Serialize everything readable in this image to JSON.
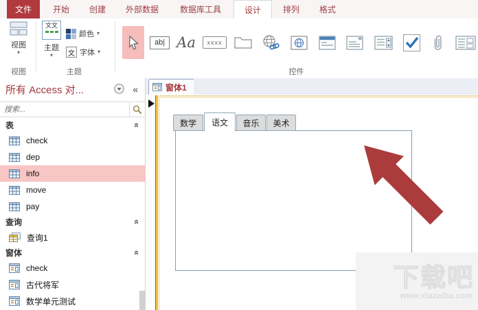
{
  "ribbon": {
    "tabs": [
      {
        "label": "文件",
        "style": "file"
      },
      {
        "label": "开始"
      },
      {
        "label": "创建"
      },
      {
        "label": "外部数据"
      },
      {
        "label": "数据库工具"
      },
      {
        "label": "设计",
        "style": "active"
      },
      {
        "label": "排列"
      },
      {
        "label": "格式"
      }
    ],
    "groups": {
      "views": {
        "label": "视图",
        "button": "视图"
      },
      "themes": {
        "label": "主题",
        "theme_button": "主题",
        "theme_icon_glyph": "文文",
        "colors_button": "颜色",
        "fonts_button": "字体",
        "fonts_icon_glyph": "文"
      },
      "controls": {
        "label": "控件",
        "textbox_glyph": "ab|",
        "label_glyph": "Aa",
        "button_glyph": "xxxx"
      }
    }
  },
  "sidebar": {
    "title": "所有 Access 对...",
    "search_placeholder": "搜索...",
    "groups": [
      {
        "label": "表",
        "items": [
          {
            "label": "check"
          },
          {
            "label": "dep"
          },
          {
            "label": "info",
            "selected": true
          },
          {
            "label": "move"
          },
          {
            "label": "pay"
          }
        ]
      },
      {
        "label": "查询",
        "items": [
          {
            "label": "查询1"
          }
        ]
      },
      {
        "label": "窗体",
        "items": [
          {
            "label": "check"
          },
          {
            "label": "古代将军"
          },
          {
            "label": "数学单元测试"
          }
        ]
      }
    ]
  },
  "document": {
    "tab_label": "窗体1"
  },
  "form": {
    "tabs": [
      {
        "label": "数学"
      },
      {
        "label": "语文",
        "selected": true
      },
      {
        "label": "音乐"
      },
      {
        "label": "美术"
      }
    ]
  },
  "watermark": {
    "title": "下载吧",
    "url": "www.xiazaiba.com"
  },
  "icons": {
    "dropdown_arrow": "▾",
    "collapse": "«",
    "chevron": "«",
    "check": "✓"
  },
  "colors": {
    "accent": "#a4373a",
    "file_tab_bg": "#b13a3e",
    "selection_pink": "#f8c6c4",
    "control_highlight": "#f7bcbc",
    "arrow_red": "#ac3c3c",
    "form_edge_gold": "#f0c04a",
    "tab_gray": "#dcdcdc",
    "tab_border": "#8fa6b4"
  }
}
